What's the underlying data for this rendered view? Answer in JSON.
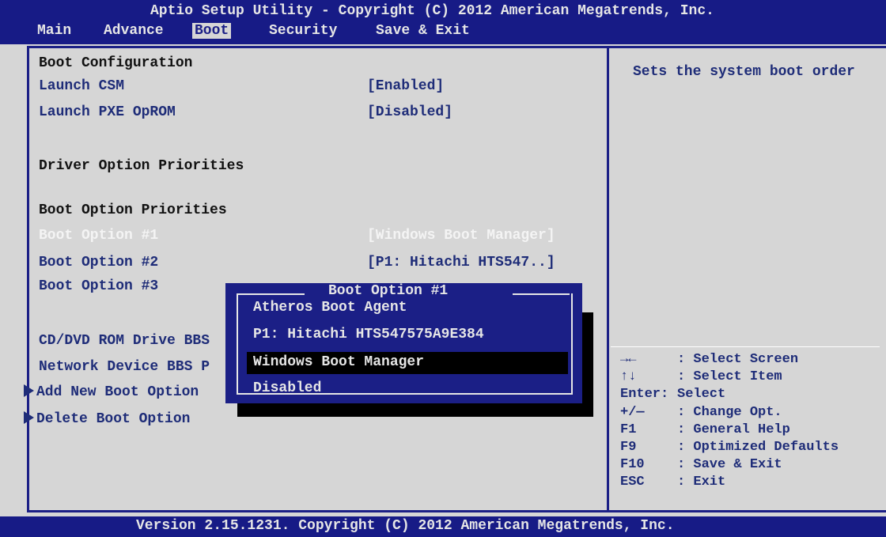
{
  "header": {
    "title": "Aptio Setup Utility - Copyright (C) 2012 American Megatrends, Inc.",
    "tabs": [
      "Main",
      "Advance",
      "Boot",
      "Security",
      "Save & Exit"
    ],
    "active_tab": "Boot"
  },
  "main": {
    "boot_configuration": "Boot Configuration",
    "launch_csm": {
      "label": "Launch CSM",
      "value": "[Enabled]"
    },
    "launch_pxe": {
      "label": "Launch PXE OpROM",
      "value": "[Disabled]"
    },
    "driver_option_priorities": "Driver Option Priorities",
    "boot_option_priorities": "Boot Option Priorities",
    "boot_option_1": {
      "label": "Boot Option #1",
      "value": "[Windows Boot Manager]"
    },
    "boot_option_2": {
      "label": "Boot Option #2",
      "value": "[P1: Hitachi HTS547..]"
    },
    "boot_option_3": {
      "label": "Boot Option #3"
    },
    "cd_dvd": "CD/DVD ROM Drive BBS",
    "network_device": "Network Device BBS P",
    "add_new_boot_option": "Add New Boot Option",
    "delete_boot_option": "Delete Boot Option"
  },
  "help": {
    "description": "Sets the system boot order",
    "keys": [
      {
        "key": "→←",
        "desc": ": Select Screen"
      },
      {
        "key": "↑↓",
        "desc": ": Select Item"
      },
      {
        "key": "Enter:",
        "desc": "Select"
      },
      {
        "key": "+/—",
        "desc": ": Change Opt."
      },
      {
        "key": "F1",
        "desc": ": General Help"
      },
      {
        "key": "F9",
        "desc": ": Optimized Defaults"
      },
      {
        "key": "F10",
        "desc": ": Save & Exit"
      },
      {
        "key": "ESC",
        "desc": ": Exit"
      }
    ]
  },
  "popup": {
    "title": "Boot Option #1",
    "options": [
      "Atheros Boot Agent",
      "P1: Hitachi HTS547575A9E384",
      "Windows Boot Manager",
      "Disabled"
    ],
    "selected": "Windows Boot Manager"
  },
  "footer": {
    "text": "Version 2.15.1231. Copyright (C) 2012 American Megatrends, Inc."
  },
  "colors": {
    "bar_blue": "#171b86",
    "panel_gray": "#d6d6d6",
    "item_blue": "#1e2c78",
    "highlight_black": "#000000"
  }
}
